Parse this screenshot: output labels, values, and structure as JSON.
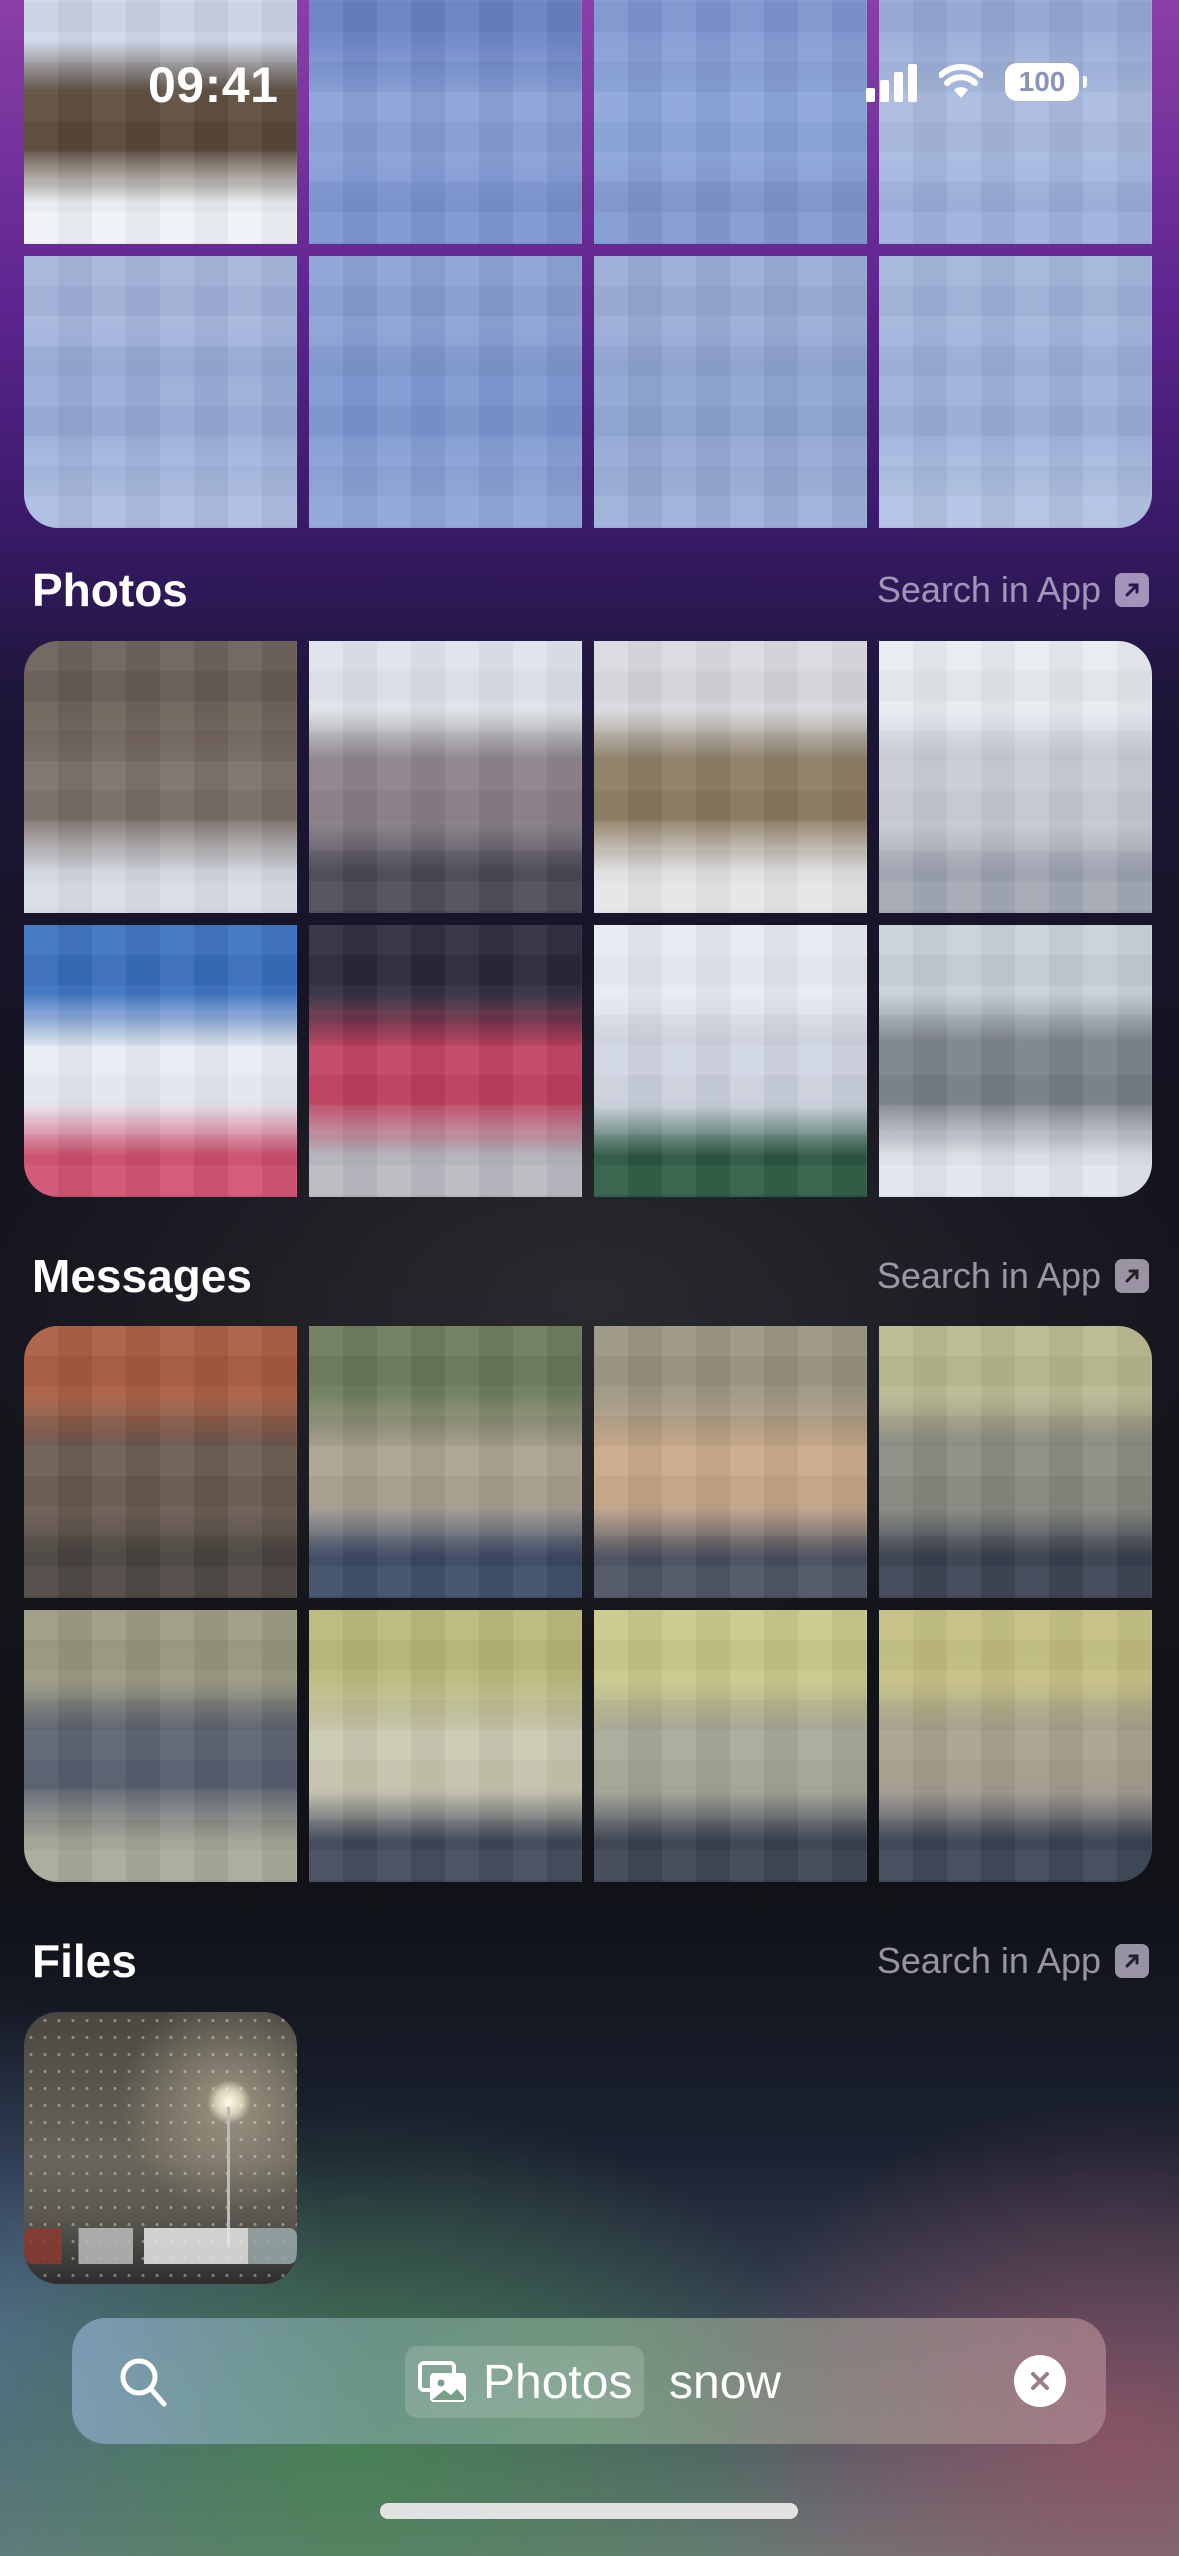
{
  "status_bar": {
    "time": "09:41",
    "battery": "100"
  },
  "top_results": {
    "tiles": [
      {
        "label": "top-result-1",
        "colors": [
          "#cfd8ec",
          "#5a4a3a",
          "#eef2f6"
        ]
      },
      {
        "label": "top-result-2",
        "colors": [
          "#6c84c8",
          "#86a0d8",
          "#7a94d0"
        ]
      },
      {
        "label": "top-result-3",
        "colors": [
          "#809ad4",
          "#8aa4da",
          "#7f98d0"
        ]
      },
      {
        "label": "top-result-4",
        "colors": [
          "#98aad8",
          "#a8bae0",
          "#9cb0dc"
        ]
      },
      {
        "label": "top-result-5",
        "colors": [
          "#a4b4dc",
          "#98acd8",
          "#aabce2"
        ]
      },
      {
        "label": "top-result-6",
        "colors": [
          "#8aa0d4",
          "#7c98d2",
          "#8ea4d8"
        ]
      },
      {
        "label": "top-result-7",
        "colors": [
          "#98aad6",
          "#8ea4d4",
          "#9aaed8"
        ]
      },
      {
        "label": "top-result-8",
        "colors": [
          "#a2b4dc",
          "#9cb0da",
          "#b0c2e4"
        ]
      }
    ]
  },
  "sections": [
    {
      "title": "Photos",
      "action_label": "Search in App",
      "tiles": [
        {
          "label": "photo-1",
          "colors": [
            "#6a5f55",
            "#7a6e68",
            "#d8dde6"
          ]
        },
        {
          "label": "photo-2",
          "colors": [
            "#dfe3ea",
            "#8a8088",
            "#4a4a55"
          ]
        },
        {
          "label": "photo-3",
          "colors": [
            "#d8dae0",
            "#8a7a60",
            "#e6e6e8"
          ]
        },
        {
          "label": "photo-4",
          "colors": [
            "#e8ecf2",
            "#c8ccd6",
            "#a0a6b2"
          ]
        },
        {
          "label": "photo-5",
          "colors": [
            "#3a70c0",
            "#e8ecf4",
            "#d05070"
          ]
        },
        {
          "label": "photo-6",
          "colors": [
            "#2a2a3a",
            "#c04060",
            "#b8b8c0"
          ]
        },
        {
          "label": "photo-7",
          "colors": [
            "#e6eaf2",
            "#d0d6e2",
            "#2e5a44"
          ]
        },
        {
          "label": "photo-8",
          "colors": [
            "#c8d0da",
            "#7a8088",
            "#e2e6ec"
          ]
        }
      ]
    },
    {
      "title": "Messages",
      "action_label": "Search in App",
      "tiles": [
        {
          "label": "message-1",
          "colors": [
            "#a85c40",
            "#6a5a50",
            "#4a4540"
          ]
        },
        {
          "label": "message-2",
          "colors": [
            "#6a7a58",
            "#aaa090",
            "#3c4a66"
          ]
        },
        {
          "label": "message-3",
          "colors": [
            "#9a9480",
            "#c8a888",
            "#4a5060"
          ]
        },
        {
          "label": "message-4",
          "colors": [
            "#b8b890",
            "#8a8a80",
            "#3a4050"
          ]
        },
        {
          "label": "message-5",
          "colors": [
            "#9a9a80",
            "#5a6070",
            "#a8a898"
          ]
        },
        {
          "label": "message-6",
          "colors": [
            "#b8b878",
            "#cac8b0",
            "#40485a"
          ]
        },
        {
          "label": "message-7",
          "colors": [
            "#c8c888",
            "#a8a898",
            "#3a4250"
          ]
        },
        {
          "label": "message-8",
          "colors": [
            "#c4c080",
            "#a8a090",
            "#3a4454"
          ]
        }
      ]
    },
    {
      "title": "Files",
      "action_label": "Search in App",
      "tiles": [
        {
          "label": "file-snow-night-parking-lot"
        }
      ]
    }
  ],
  "search_bar": {
    "scope_token": "Photos",
    "scope_icon": "photos-stack-icon",
    "query": "snow",
    "leading_icon": "search-icon",
    "clear_icon": "clear-x-icon"
  }
}
